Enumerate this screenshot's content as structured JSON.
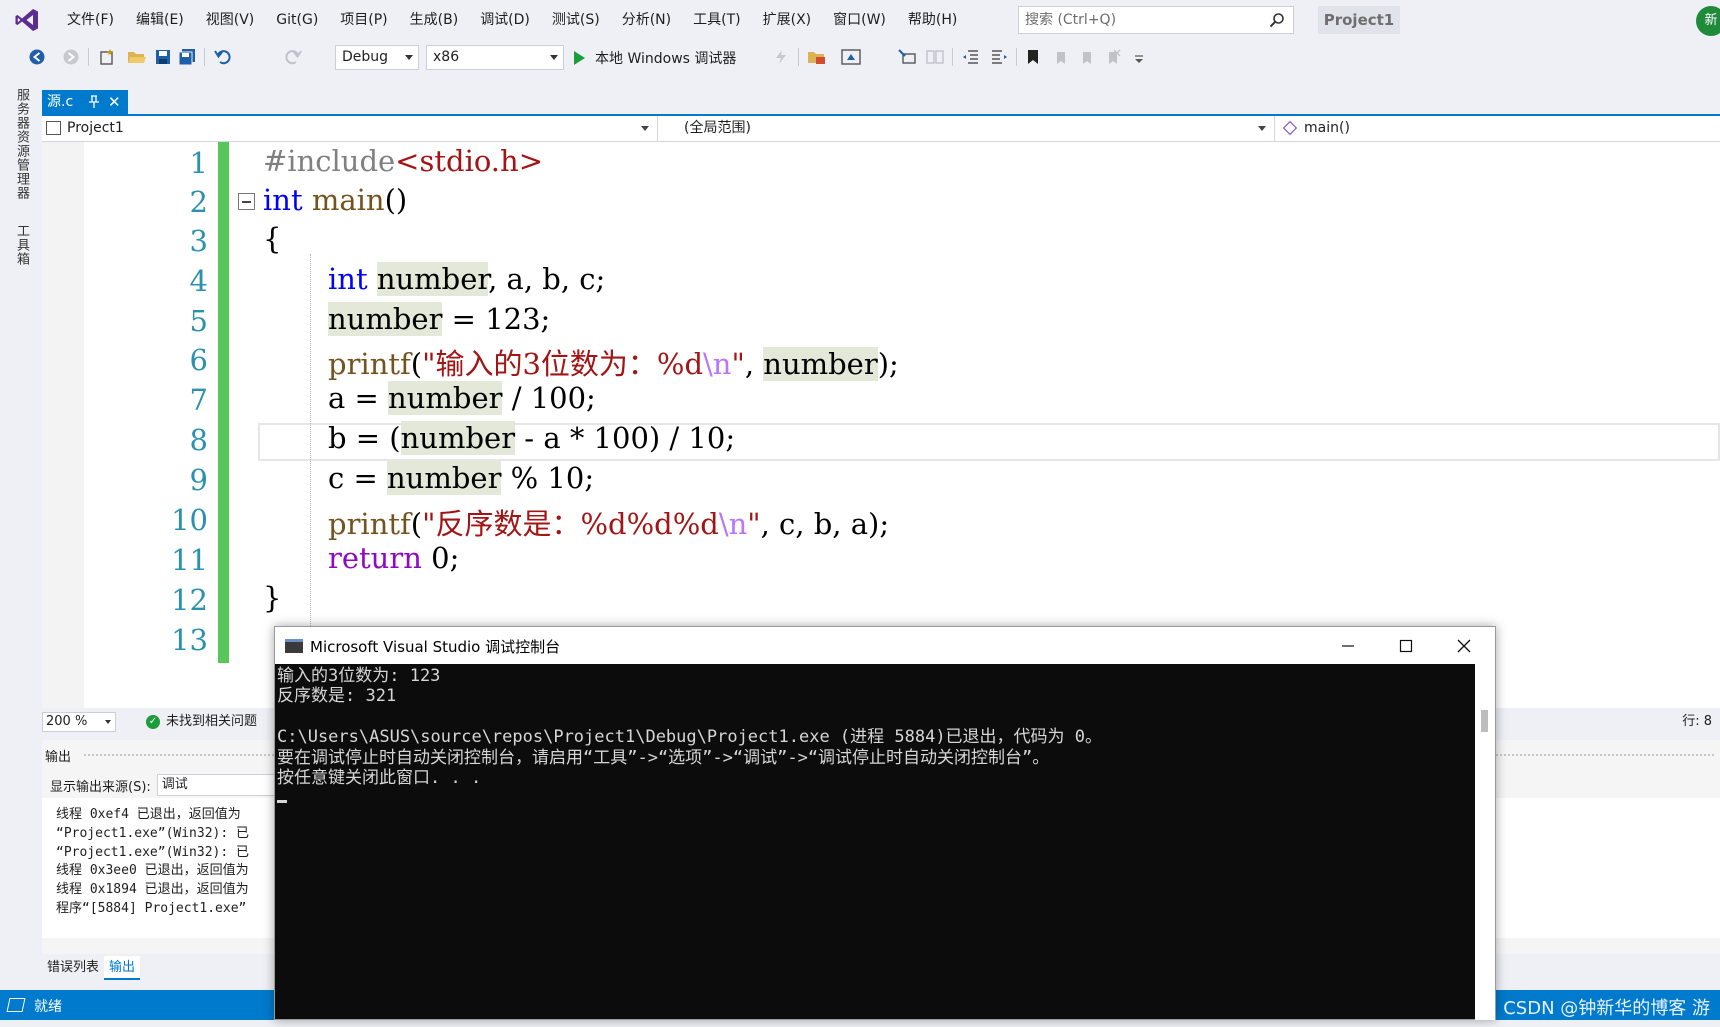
{
  "menubar": {
    "items": [
      "文件(F)",
      "编辑(E)",
      "视图(V)",
      "Git(G)",
      "项目(P)",
      "生成(B)",
      "调试(D)",
      "测试(S)",
      "分析(N)",
      "工具(T)",
      "扩展(X)",
      "窗口(W)",
      "帮助(H)"
    ],
    "search_placeholder": "搜索 (Ctrl+Q)",
    "project_name": "Project1",
    "avatar_text": "新"
  },
  "toolbar": {
    "config": "Debug",
    "platform": "x86",
    "run_label": "本地 Windows 调试器"
  },
  "left_strip": {
    "tabs": [
      "服务器资源管理器",
      "工具箱"
    ]
  },
  "document": {
    "tab_name": "源.c"
  },
  "navbar": {
    "project": "Project1",
    "scope": "(全局范围)",
    "member": "main()"
  },
  "editor": {
    "line_numbers": [
      "1",
      "2",
      "3",
      "4",
      "5",
      "6",
      "7",
      "8",
      "9",
      "10",
      "11",
      "12",
      "13"
    ]
  },
  "ed_status": {
    "zoom": "200 %",
    "issues": "未找到相关问题",
    "line": "行: 8"
  },
  "output": {
    "title": "输出",
    "source_label": "显示输出来源(S):",
    "source_value": "调试",
    "lines": [
      "线程 0xef4 已退出，返回值为",
      "“Project1.exe”(Win32): 已",
      "“Project1.exe”(Win32): 已",
      "线程 0x3ee0 已退出，返回值为",
      "线程 0x1894 已退出，返回值为",
      "程序“[5884] Project1.exe”"
    ]
  },
  "bottom_tabs": [
    "错误列表",
    "输出"
  ],
  "statusbar": {
    "ready": "就绪",
    "watermark": "CSDN @钟新华的博客 游"
  },
  "console": {
    "title": "Microsoft Visual Studio 调试控制台",
    "lines": [
      "输入的3位数为: 123",
      "反序数是: 321",
      "",
      "C:\\Users\\ASUS\\source\\repos\\Project1\\Debug\\Project1.exe (进程 5884)已退出，代码为 0。",
      "要在调试停止时自动关闭控制台，请启用“工具”->“选项”->“调试”->“调试停止时自动关闭控制台”。",
      "按任意键关闭此窗口. . ."
    ]
  },
  "colors": {
    "accent": "#007acc",
    "change_bar": "#57c75a",
    "keyword": "#0000ff",
    "string": "#a31515",
    "line_number": "#2b91af"
  }
}
